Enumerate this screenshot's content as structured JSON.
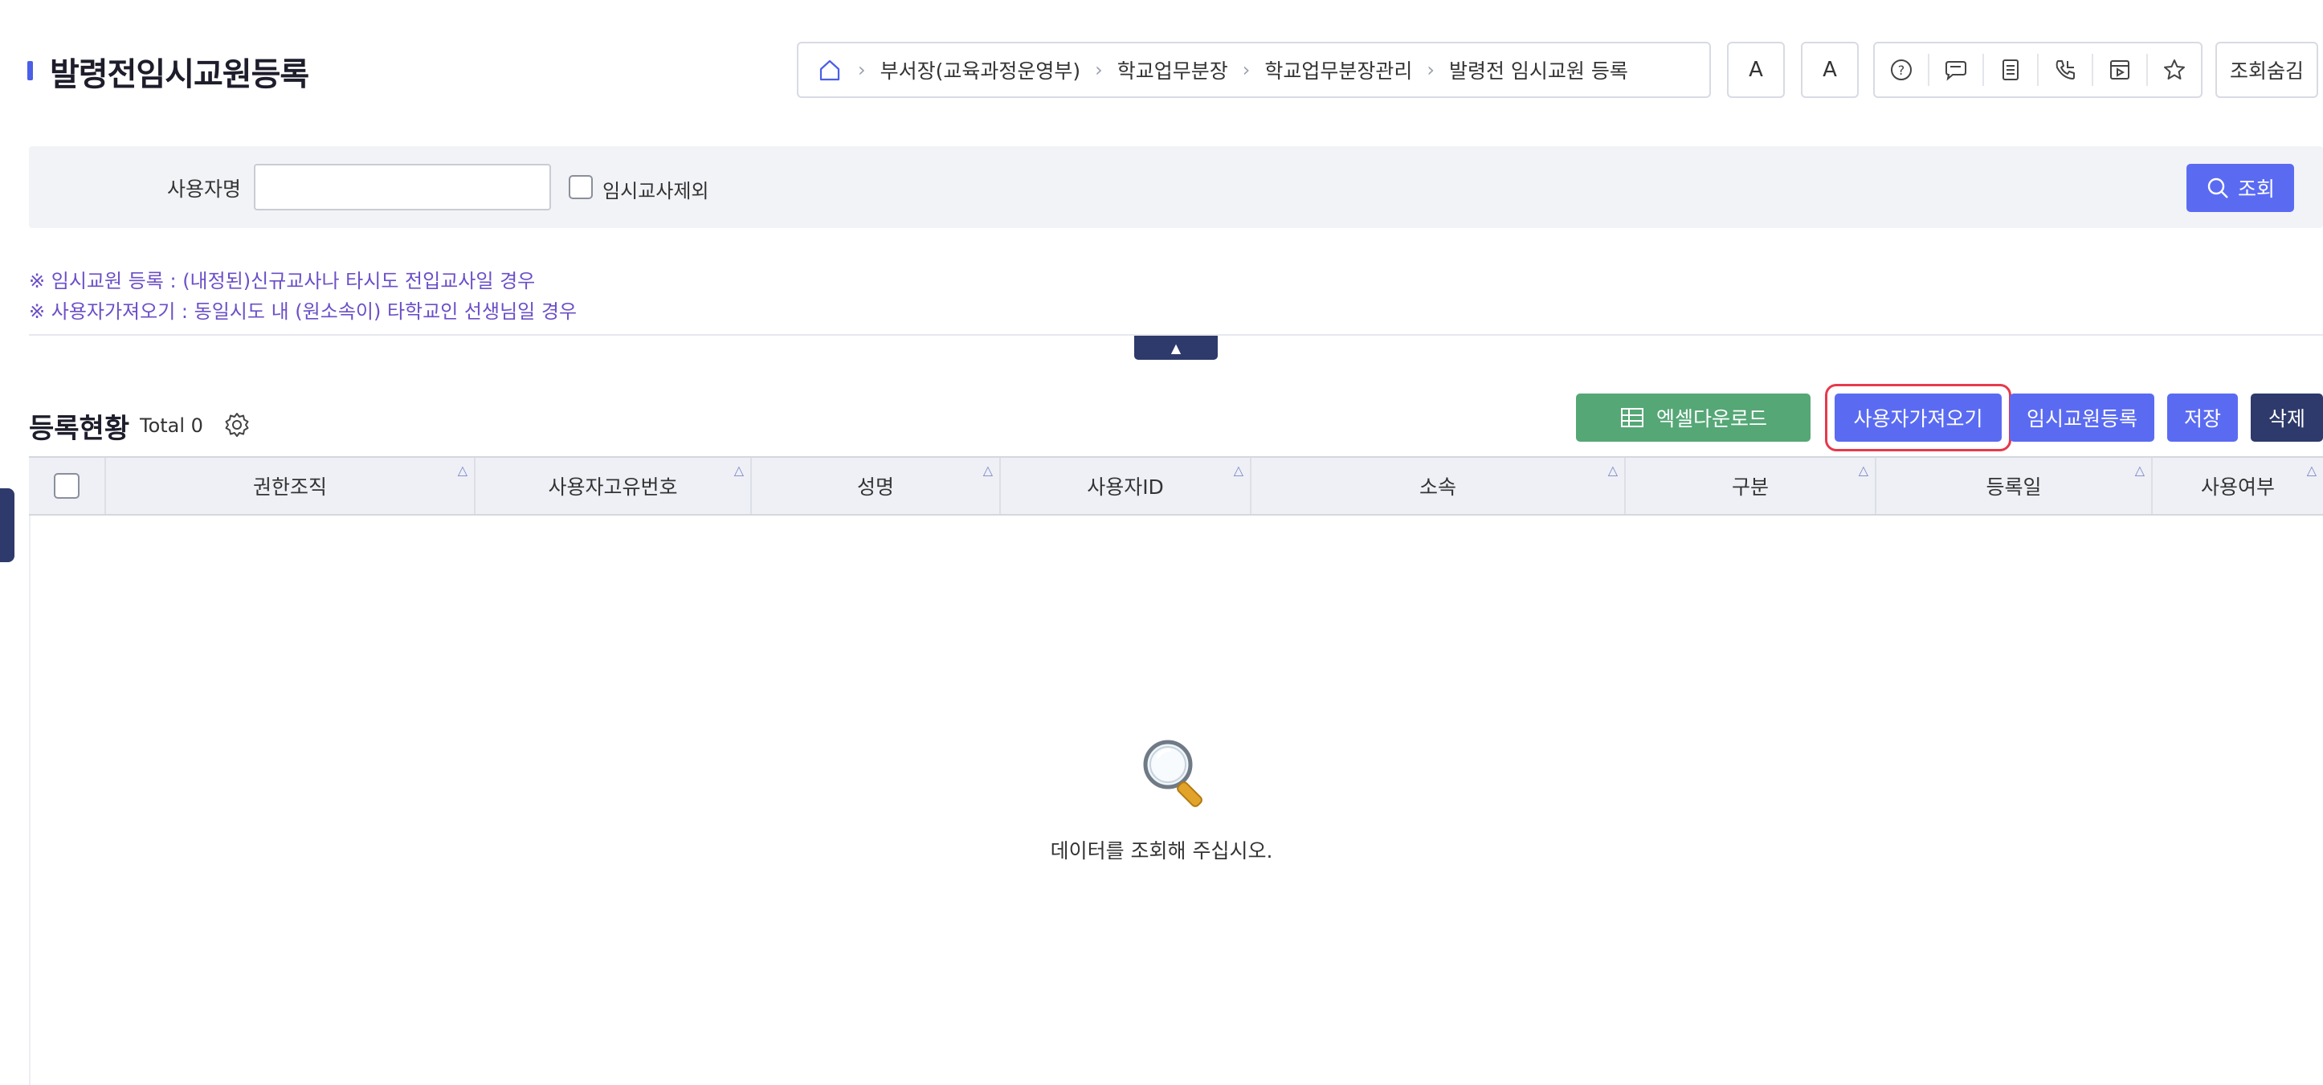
{
  "page": {
    "title": "발령전임시교원등록"
  },
  "breadcrumb": {
    "home_icon": "home-icon",
    "items": [
      "부서장(교육과정운영부)",
      "학교업무분장",
      "학교업무분장관리",
      "발령전 임시교원 등록"
    ]
  },
  "toolbar": {
    "font_larger": "A",
    "font_smaller": "A",
    "icons": [
      "help-icon",
      "chat-icon",
      "document-icon",
      "phone-icon",
      "media-icon",
      "star-icon"
    ],
    "hide_search": "조회숨김"
  },
  "search": {
    "user_label": "사용자명",
    "user_value": "",
    "exclude_temp_label": "임시교사제외",
    "exclude_temp_checked": false,
    "search_button": "조회"
  },
  "notes": {
    "line1": "※ 임시교원 등록 : (내정된)신규교사나 타시도 전입교사일 경우",
    "line2": "※ 사용자가져오기 : 동일시도 내 (원소속이) 타학교인 선생님일 경우"
  },
  "section": {
    "title": "등록현황",
    "total": "Total 0"
  },
  "actions": {
    "excel_download": "엑셀다운로드",
    "import_user": "사용자가져오기",
    "register_temp": "임시교원등록",
    "save": "저장",
    "delete": "삭제"
  },
  "grid": {
    "columns": [
      "권한조직",
      "사용자고유번호",
      "성명",
      "사용자ID",
      "소속",
      "구분",
      "등록일",
      "사용여부"
    ],
    "rows": [],
    "empty_message": "데이터를 조회해 주십시오."
  },
  "colors": {
    "primary": "#5a6bf2",
    "dark": "#2e3a6b",
    "excel": "#55a776",
    "note": "#6b4fc8",
    "highlight": "#e6394b"
  }
}
